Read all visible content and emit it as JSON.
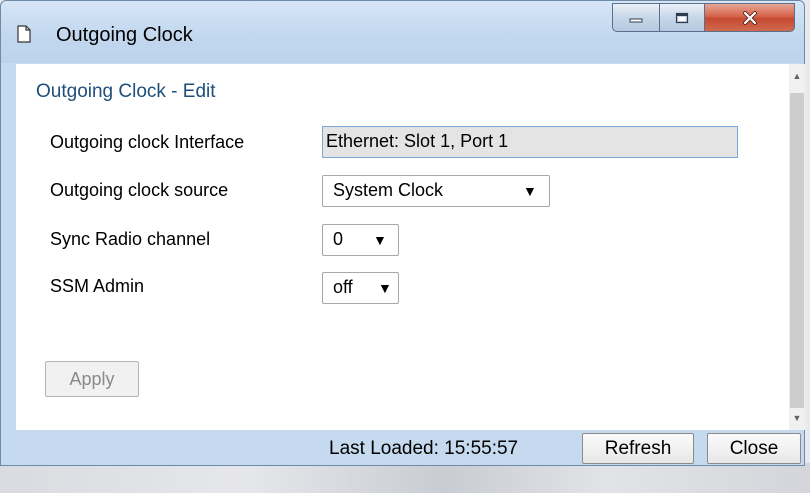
{
  "window": {
    "title": "Outgoing Clock"
  },
  "form": {
    "section_title": "Outgoing Clock - Edit",
    "fields": [
      {
        "label": "Outgoing clock Interface",
        "value": "Ethernet: Slot 1, Port 1"
      },
      {
        "label": "Outgoing clock source",
        "value": "System Clock"
      },
      {
        "label": "Sync Radio channel",
        "value": "0"
      },
      {
        "label": "SSM Admin",
        "value": "off"
      }
    ],
    "apply_label": "Apply"
  },
  "footer": {
    "last_loaded": "Last Loaded: 15:55:57",
    "refresh_label": "Refresh",
    "close_label": "Close"
  },
  "icons": {
    "title_icon": "document-icon",
    "dropdown_arrow": "▼",
    "scroll_up": "▲",
    "scroll_down": "▼"
  },
  "colors": {
    "window_frame": "#c5d9ef",
    "section_title": "#1f4e7a",
    "close_button": "#c44b31"
  }
}
